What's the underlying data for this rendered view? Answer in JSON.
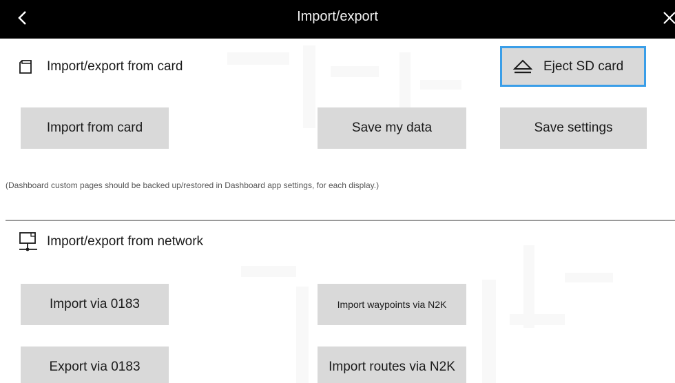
{
  "header": {
    "title": "Import/export",
    "back_icon": "chevron-left-icon",
    "close_icon": "close-icon"
  },
  "card_section": {
    "icon": "sd-card-icon",
    "label": "Import/export from card",
    "eject": {
      "icon": "eject-icon",
      "label": "Eject SD card"
    },
    "buttons": {
      "import": "Import from card",
      "save_data": "Save my data",
      "save_settings": "Save settings"
    },
    "note": "(Dashboard custom pages should be backed up/restored in Dashboard app settings, for each display.)"
  },
  "network_section": {
    "icon": "network-icon",
    "label": "Import/export from network",
    "buttons": {
      "import_0183": "Import via 0183",
      "import_waypoints_n2k": "Import waypoints via N2K",
      "export_0183": "Export via 0183",
      "import_routes_n2k": "Import routes via N2K"
    }
  },
  "colors": {
    "titlebar": "#000000",
    "button": "#d9d9d9",
    "focus": "#3a9ee8"
  }
}
